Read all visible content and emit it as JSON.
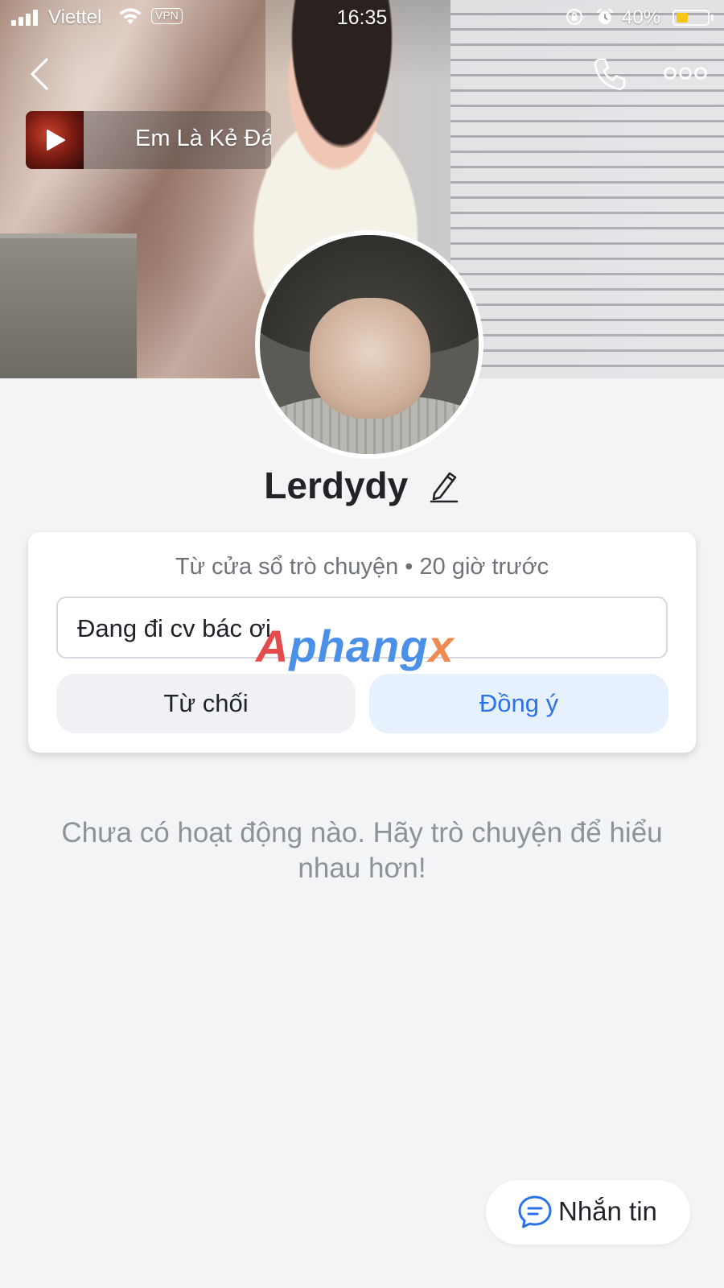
{
  "status_bar": {
    "carrier": "Viettel",
    "vpn": "VPN",
    "time": "16:35",
    "battery": "40%",
    "battery_level": 0.4
  },
  "header": {
    "back_icon": "chevron-left-icon",
    "call_icon": "phone-icon",
    "more_icon": "more-horizontal-icon"
  },
  "music": {
    "title": "Em Là Kẻ Đá",
    "play_icon": "play-icon"
  },
  "profile": {
    "name": "Lerdydy",
    "edit_icon": "pencil-icon"
  },
  "friend_request": {
    "meta": "Từ cửa sổ trò chuyện • 20 giờ trước",
    "message": "Đang đi cv bác ơi",
    "decline_label": "Từ chối",
    "accept_label": "Đồng ý"
  },
  "watermark": {
    "a": "A",
    "mid": "phang",
    "x": "x"
  },
  "activity": {
    "empty_text": "Chưa có hoạt động nào. Hãy trò chuyện để hiểu nhau hơn!"
  },
  "fab": {
    "label": "Nhắn tin",
    "icon": "chat-bubble-icon"
  },
  "colors": {
    "accent": "#2b72e6",
    "accept_bg": "#e7f1fd",
    "background": "#f3f4f6",
    "battery_fill": "#f5c518"
  }
}
